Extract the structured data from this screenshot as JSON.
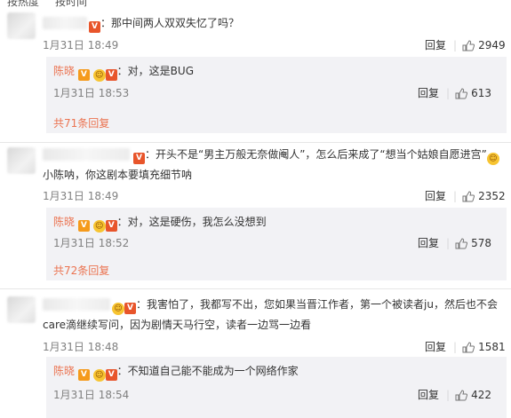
{
  "topbar": {
    "tab1": "按热度",
    "tab2": "按时间"
  },
  "comments": [
    {
      "text": "：那中间两人双双失忆了吗？",
      "date": "1月31日 18:49",
      "reply_label": "回复",
      "likes": "2949",
      "reply": {
        "name": "陈晓",
        "text": "：对，这是BUG",
        "date": "1月31日 18:53",
        "reply_label": "回复",
        "likes": "613"
      },
      "more": "共71条回复"
    },
    {
      "text": "：开头不是“男主万般无奈做阉人”，怎么后来成了“想当个姑娘自愿进宫”",
      "text2": "小陈呐，你这剧本要填充细节呐",
      "date": "1月31日 18:49",
      "reply_label": "回复",
      "likes": "2352",
      "reply": {
        "name": "陈晓",
        "text": "：对，这是硬伤，我怎么没想到",
        "date": "1月31日 18:52",
        "reply_label": "回复",
        "likes": "578"
      },
      "more": "共72条回复"
    },
    {
      "text": "：我害怕了，我都写不出，您如果当晋江作者，第一个被读者ju，然后也不会",
      "text2": "care滴继续写问，因为剧情天马行空，读者一边骂一边看",
      "date": "1月31日 18:48",
      "reply_label": "回复",
      "likes": "1581",
      "reply": {
        "name": "陈晓",
        "text": "：不知道自己能不能成为一个网络作家",
        "date": "1月31日 18:54",
        "reply_label": "回复",
        "likes": "422"
      }
    }
  ],
  "badge_letter": "V",
  "colors": {
    "name": "#eb7350",
    "reply_bg": "#f2f2f5",
    "meta": "#808080"
  }
}
